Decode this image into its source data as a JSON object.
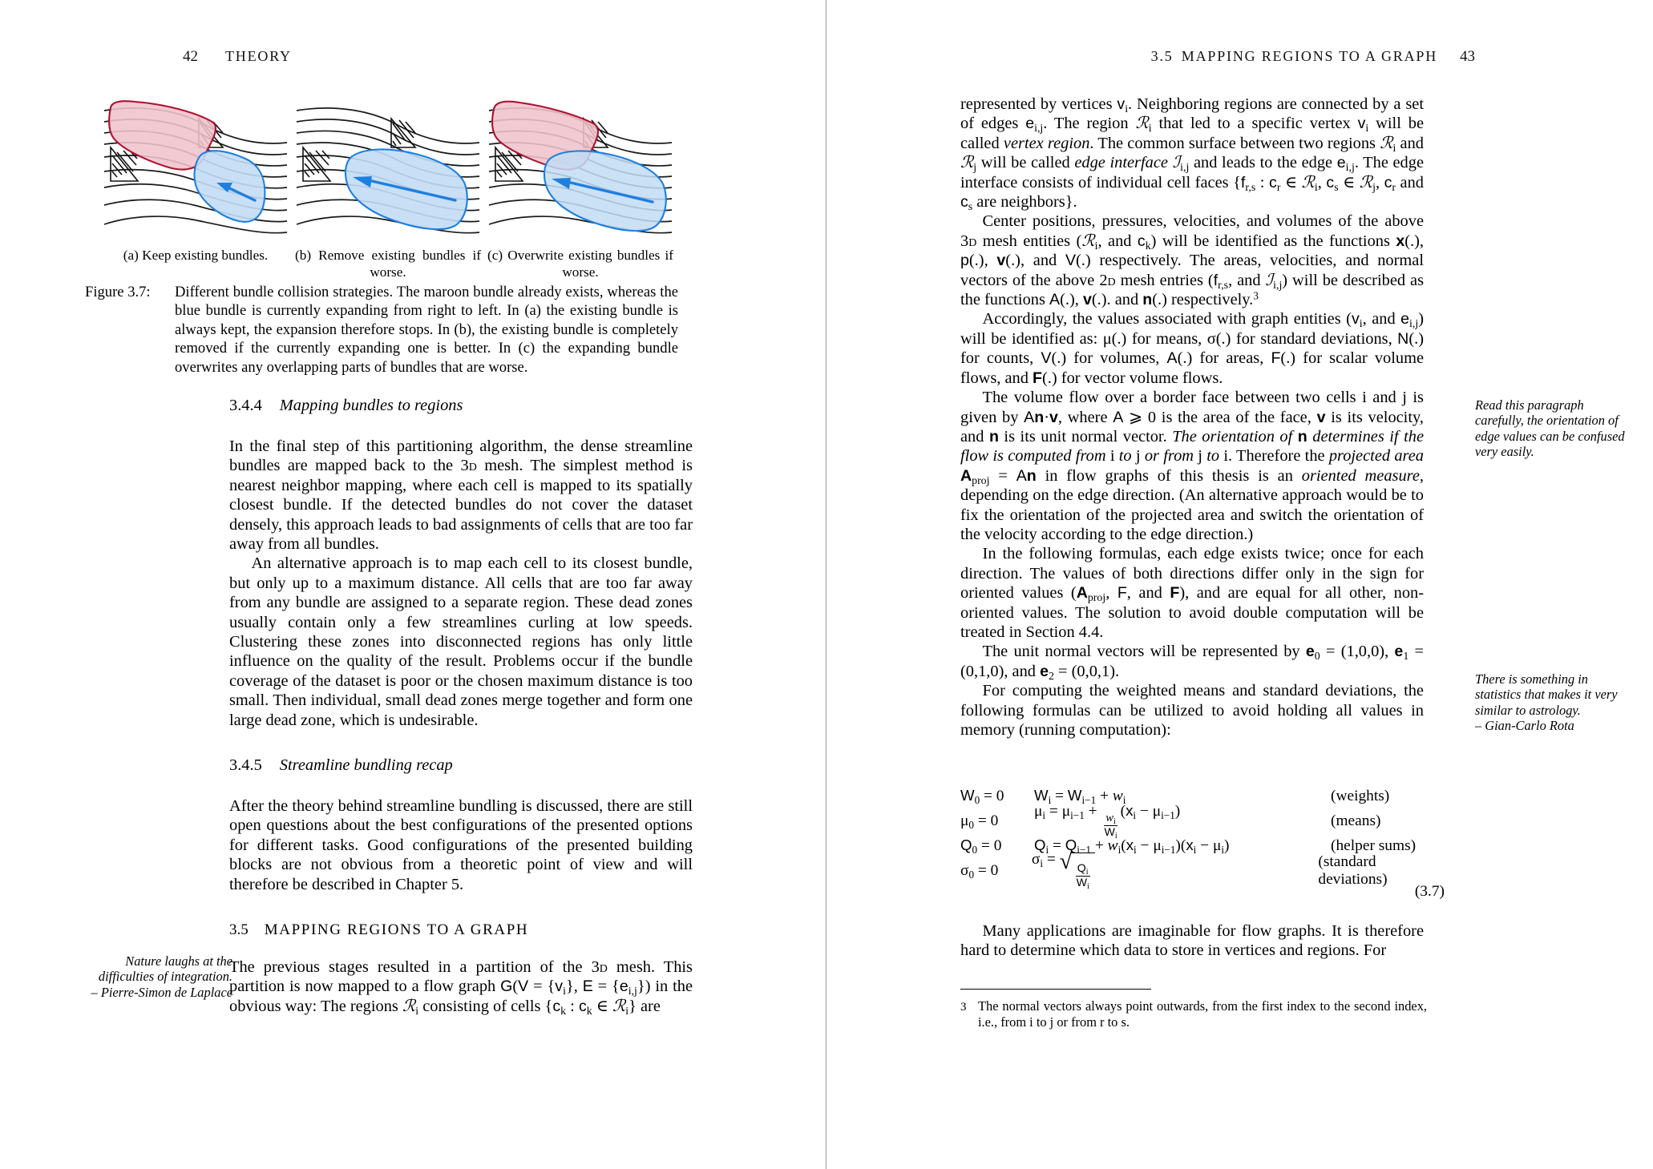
{
  "document": {
    "kind": "two-page book spread",
    "colors": {
      "maroon_fill": "#f0c3cc",
      "maroon_stroke": "#b0112f",
      "blue_fill": "#c3dcf5",
      "blue_stroke": "#1f7fe0",
      "streamline": "#1a1a1a",
      "gutter": "#9a9a9a"
    }
  },
  "left_page": {
    "header": {
      "folio": "42",
      "title": "THEORY"
    },
    "figure": {
      "subfigures": [
        {
          "key": "a",
          "caption": "(a) Keep existing bundles."
        },
        {
          "key": "b",
          "caption": "(b) Remove existing bundles if worse."
        },
        {
          "key": "c",
          "caption": "(c) Overwrite existing bundles if worse."
        }
      ],
      "caption_label": "Figure 3.7:",
      "caption_body": "Different bundle collision strategies. The maroon bundle already exists, whereas the blue bundle is currently expanding from right to left. In (a) the existing bundle is always kept, the expansion therefore stops. In (b), the existing bundle is completely removed if the currently expanding one is better. In (c) the expanding bundle overwrites any overlapping parts of bundles that are worse."
    },
    "subsection_344": {
      "number": "3.4.4",
      "title": "Mapping bundles to regions",
      "para_1": "In the final step of this partitioning algorithm, the dense streamline bundles are mapped back to the 3D mesh. The simplest method is nearest neighbor mapping, where each cell is mapped to its spatially closest bundle. If the detected bundles do not cover the dataset densely, this approach leads to bad assignments of cells that are too far away from all bundles.",
      "para_2": "An alternative approach is to map each cell to its closest bundle, but only up to a maximum distance. All cells that are too far away from any bundle are assigned to a separate region. These dead zones usually contain only a few streamlines curling at low speeds. Clustering these zones into disconnected regions has only little influence on the quality of the result. Problems occur if the bundle coverage of the dataset is poor or the chosen maximum distance is too small. Then individual, small dead zones merge together and form one large dead zone, which is undesirable."
    },
    "subsection_345": {
      "number": "3.4.5",
      "title": "Streamline bundling recap",
      "para_1": "After the theory behind streamline bundling is discussed, there are still open questions about the best configurations of the presented options for different tasks. Good configurations of the presented building blocks are not obvious from a theoretic point of view and will therefore be described in Chapter 5."
    },
    "section_35": {
      "number": "3.5",
      "title": "MAPPING REGIONS TO A GRAPH",
      "para_1_part1": "The previous stages resulted in a partition of the 3D mesh. This partition is now mapped to a flow graph G(V = {v",
      "para_1_part2": "}, E = {e",
      "para_1_part3": "}) in the obvious way: The regions R",
      "para_1_part4": " consisting of cells {c",
      "para_1_part5": " : c",
      "para_1_part6": " ∈ R",
      "para_1_part7": "} are"
    },
    "margin_note": {
      "quote": "Nature laughs at the difficulties of integration.",
      "attribution": "– Pierre-Simon de Laplace"
    }
  },
  "right_page": {
    "header": {
      "section_number": "3.5",
      "title": "MAPPING REGIONS TO A GRAPH",
      "folio": "43"
    },
    "paragraphs": {
      "p1": "represented by vertices v_i. Neighboring regions are connected by a set of edges e_i,j. The region R_i that led to a specific vertex v_i will be called vertex region. The common surface between two regions R_i and R_j will be called edge interface I_i,j and leads to the edge e_i,j. The edge interface consists of individual cell faces {f_r,s : c_r ∈ R_i, c_s ∈ R_j, c_r and c_s are neighbors}.",
      "p2": "Center positions, pressures, velocities, and volumes of the above 3D mesh entities (R_i, and c_k) will be identified as the functions x(.), p(.), v(.), and V(.) respectively. The areas, velocities, and normal vectors of the above 2D mesh entries (f_r,s, and I_i,j) will be described as the functions A(.), v(.). and n(.) respectively.3",
      "p3": "Accordingly, the values associated with graph entities (v_i, and e_i,j) will be identified as: μ(.) for means, σ(.) for standard deviations, N(.) for counts, V(.) for volumes, A(.) for areas, F(.) for scalar volume flows, and F(.) for vector volume flows.",
      "p4": "The volume flow over a border face between two cells i and j is given by An · v, where A ⩾ 0 is the area of the face, v is its velocity, and n is its unit normal vector. The orientation of n determines if the flow is computed from i to j or from j to i. Therefore the projected area A_proj = An in flow graphs of this thesis is an oriented measure, depending on the edge direction. (An alternative approach would be to fix the orientation of the projected area and switch the orientation of the velocity according to the edge direction.)",
      "p5": "In the following formulas, each edge exists twice; once for each direction. The values of both directions differ only in the sign for oriented values (A_proj, F, and F), and are equal for all other, non-oriented values. The solution to avoid double computation will be treated in Section 4.4.",
      "p6": "The unit normal vectors will be represented by e_0 = (1,0,0), e_1 = (0,1,0), and e_2 = (0,0,1).",
      "p7": "For computing the weighted means and standard deviations, the following formulas can be utilized to avoid holding all values in memory (running computation):",
      "p8": "Many applications are imaginable for flow graphs. It is therefore hard to determine which data to store in vertices and regions. For"
    },
    "equations": {
      "number": "(3.7)",
      "rows": [
        {
          "init": "W₀ = 0",
          "recur": "Wᵢ = Wᵢ₋₁ + wᵢ",
          "label": "(weights)"
        },
        {
          "init": "μ₀ = 0",
          "recur": "μᵢ = μᵢ₋₁ + (wᵢ/Wᵢ)(xᵢ − μᵢ₋₁)",
          "label": "(means)"
        },
        {
          "init": "Q₀ = 0",
          "recur": "Qᵢ = Qᵢ₋₁ + wᵢ(xᵢ − μᵢ₋₁)(xᵢ − μᵢ)",
          "label": "(helper sums)"
        },
        {
          "init": "σ₀ = 0",
          "recur": "σᵢ = √(Qᵢ/Wᵢ)",
          "label": "(standard deviations)"
        }
      ]
    },
    "margin_notes": [
      {
        "text": "Read this paragraph carefully, the orientation of edge values can be confused very easily."
      },
      {
        "quote": "There is something in statistics that makes it very similar to astrology.",
        "attribution": "– Gian-Carlo Rota"
      }
    ],
    "footnote": {
      "marker": "3",
      "text": "The normal vectors always point outwards, from the first index to the second index, i.e., from i to j or from r to s."
    }
  }
}
